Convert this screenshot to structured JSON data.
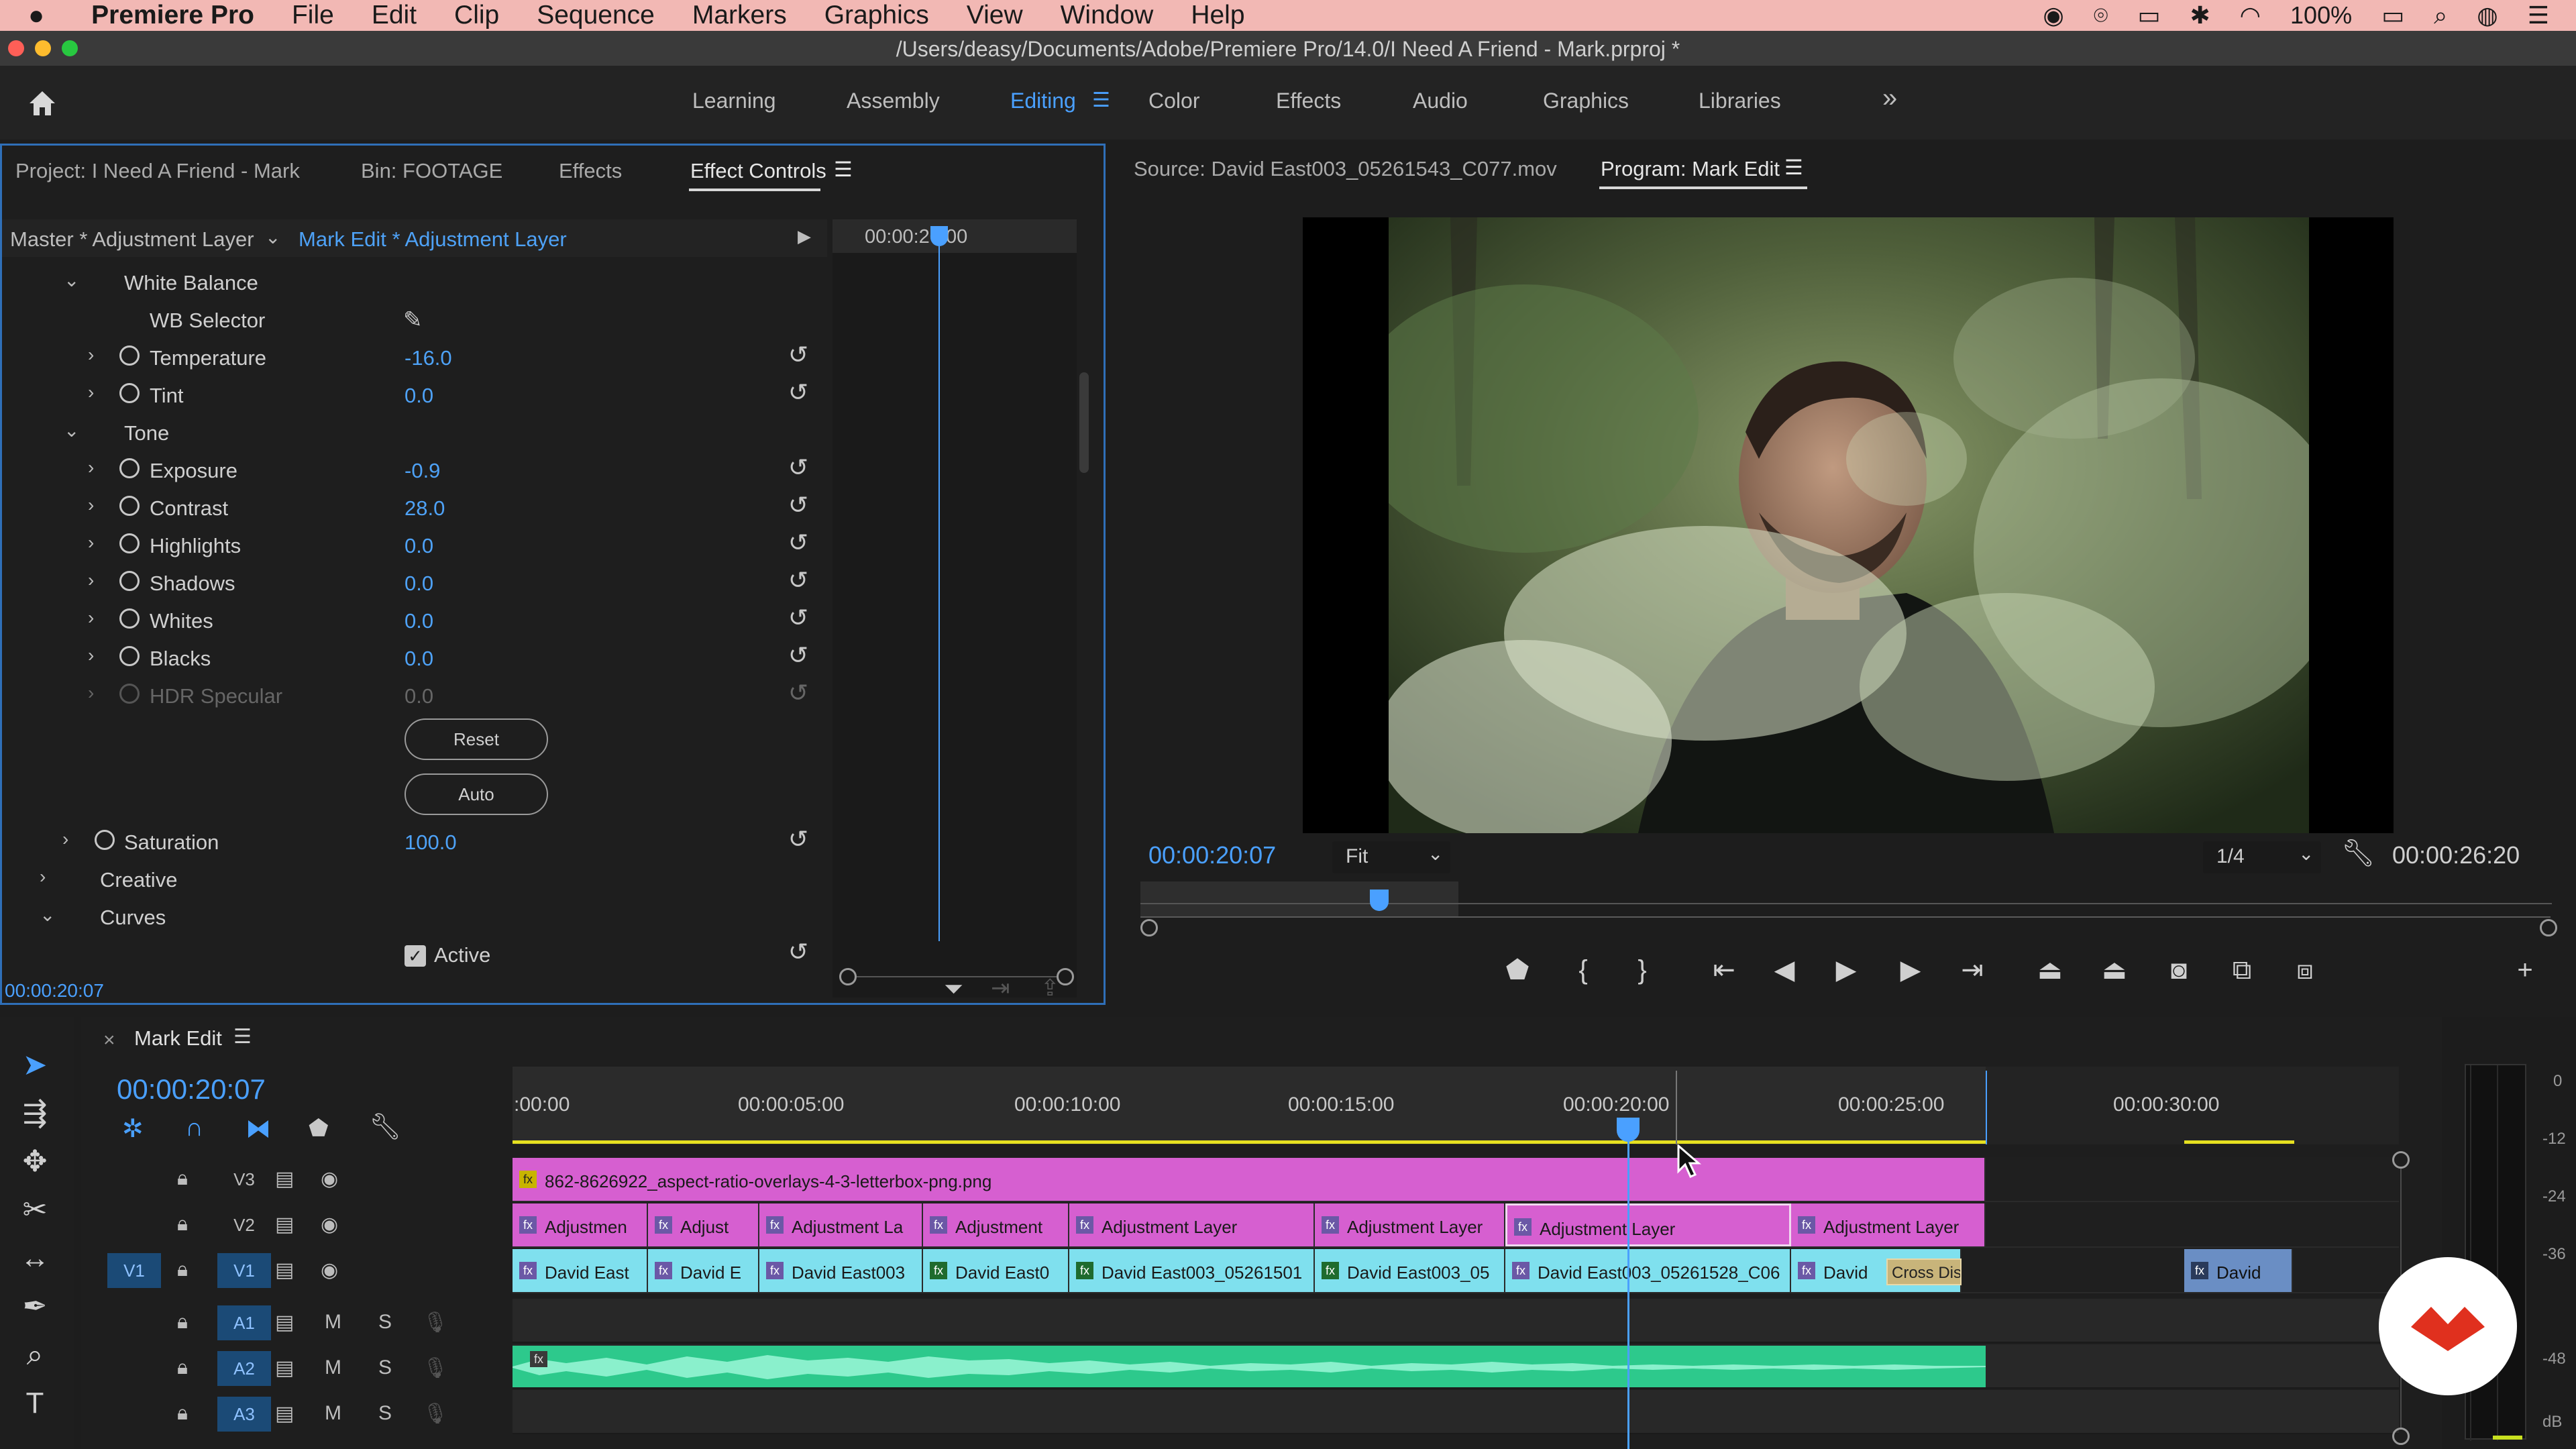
{
  "menubar": {
    "app": "Premiere Pro",
    "items": [
      "File",
      "Edit",
      "Clip",
      "Sequence",
      "Markers",
      "Graphics",
      "View",
      "Window",
      "Help"
    ],
    "battery": "100%"
  },
  "window": {
    "title": "/Users/deasy/Documents/Adobe/Premiere Pro/14.0/I Need A Friend - Mark.prproj *"
  },
  "workspaces": [
    "Learning",
    "Assembly",
    "Editing",
    "Color",
    "Effects",
    "Audio",
    "Graphics",
    "Libraries"
  ],
  "workspace_more": "»",
  "effect_panel": {
    "tabs": [
      "Project: I Need A Friend - Mark",
      "Bin: FOOTAGE",
      "Effects",
      "Effect Controls"
    ],
    "master": "Master * Adjustment Layer",
    "clip": "Mark Edit * Adjustment Layer",
    "mini_timecode": "00:00:20:00",
    "sections": {
      "white_balance": "White Balance",
      "wb_selector": "WB Selector",
      "tone": "Tone",
      "creative": "Creative",
      "curves": "Curves"
    },
    "params": [
      {
        "label": "Temperature",
        "value": "-16.0"
      },
      {
        "label": "Tint",
        "value": "0.0"
      },
      {
        "label": "Exposure",
        "value": "-0.9"
      },
      {
        "label": "Contrast",
        "value": "28.0"
      },
      {
        "label": "Highlights",
        "value": "0.0"
      },
      {
        "label": "Shadows",
        "value": "0.0"
      },
      {
        "label": "Whites",
        "value": "0.0"
      },
      {
        "label": "Blacks",
        "value": "0.0"
      },
      {
        "label": "HDR Specular",
        "value": "0.0"
      }
    ],
    "reset_label": "Reset",
    "auto_label": "Auto",
    "saturation_label": "Saturation",
    "saturation_value": "100.0",
    "active_label": "Active",
    "footer_timecode": "00:00:20:07"
  },
  "monitors": {
    "source_tab": "Source: David East003_05261543_C077.mov",
    "program_tab": "Program: Mark Edit",
    "timecode": "00:00:20:07",
    "fit": "Fit",
    "resolution": "1/4",
    "duration": "00:00:26:20"
  },
  "timeline": {
    "title": "Mark Edit",
    "timecode": "00:00:20:07",
    "ruler": [
      ":00:00",
      "00:00:05:00",
      "00:00:10:00",
      "00:00:15:00",
      "00:00:20:00",
      "00:00:25:00",
      "00:00:30:00"
    ],
    "tracks": {
      "v3": "V3",
      "v2": "V2",
      "v1": "V1",
      "v1_src": "V1",
      "a1": "A1",
      "a2": "A2",
      "a3": "A3",
      "m": "M",
      "s": "S"
    },
    "v3_clip": "862-8626922_aspect-ratio-overlays-4-3-letterbox-png.png",
    "v2_clips": [
      "Adjustmen",
      "Adjust",
      "Adjustment La",
      "Adjustment",
      "Adjustment Layer",
      "Adjustment Layer",
      "Adjustment Layer",
      "Adjustment Layer"
    ],
    "v1_clips": [
      "David East",
      "David E",
      "David East003",
      "David East0",
      "David East003_05261501",
      "David East003_05",
      "David East003_05261528_C06",
      "David",
      "David"
    ],
    "transition": "Cross Dis",
    "fx": "fx"
  },
  "meter": {
    "labels": [
      "0",
      "-12",
      "-24",
      "-36",
      "-48",
      "dB"
    ]
  },
  "colors": {
    "accent": "#4aa0ff",
    "clip_magenta": "#d65fd0",
    "clip_cyan": "#7fe0ee",
    "audio_green": "#2dc98c",
    "menubar": "#f2b8b4"
  }
}
